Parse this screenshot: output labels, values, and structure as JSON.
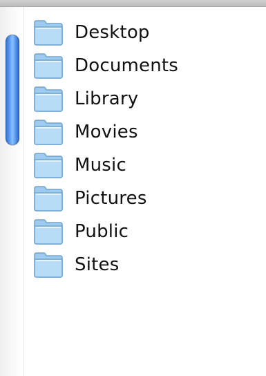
{
  "accent_colors": {
    "scroll_thumb": "#5b9bf0",
    "folder_fill": "#b9dcf6",
    "folder_tab": "#9fcbef",
    "folder_outline": "#6fa3d0"
  },
  "folders": [
    {
      "label": "Desktop",
      "icon": "folder-icon"
    },
    {
      "label": "Documents",
      "icon": "folder-icon"
    },
    {
      "label": "Library",
      "icon": "folder-icon"
    },
    {
      "label": "Movies",
      "icon": "folder-icon"
    },
    {
      "label": "Music",
      "icon": "folder-icon"
    },
    {
      "label": "Pictures",
      "icon": "folder-icon"
    },
    {
      "label": "Public",
      "icon": "folder-icon"
    },
    {
      "label": "Sites",
      "icon": "folder-icon"
    }
  ]
}
